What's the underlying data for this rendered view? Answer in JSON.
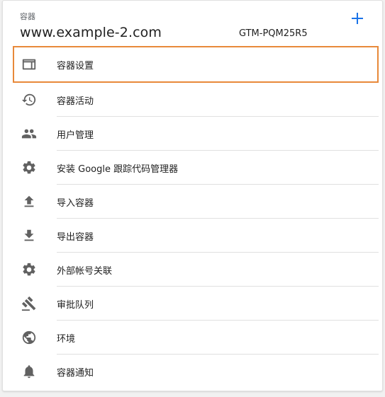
{
  "header": {
    "section_label": "容器",
    "container_name": "www.example-2.com",
    "container_id": "GTM-PQM25R5",
    "add_icon": "plus-icon"
  },
  "menu": {
    "items": [
      {
        "label": "容器设置",
        "icon": "browser-window-icon",
        "selected": true
      },
      {
        "label": "容器活动",
        "icon": "history-icon"
      },
      {
        "label": "用户管理",
        "icon": "people-icon"
      },
      {
        "label": "安装 Google 跟踪代码管理器",
        "icon": "gear-icon"
      },
      {
        "label": "导入容器",
        "icon": "upload-icon"
      },
      {
        "label": "导出容器",
        "icon": "download-icon"
      },
      {
        "label": "外部帐号关联",
        "icon": "gear-icon"
      },
      {
        "label": "审批队列",
        "icon": "gavel-icon"
      },
      {
        "label": "环境",
        "icon": "globe-icon"
      },
      {
        "label": "容器通知",
        "icon": "bell-icon"
      }
    ]
  },
  "colors": {
    "accent": "#1a73e8",
    "selected_outline": "#e8893a",
    "icon": "#616161"
  }
}
